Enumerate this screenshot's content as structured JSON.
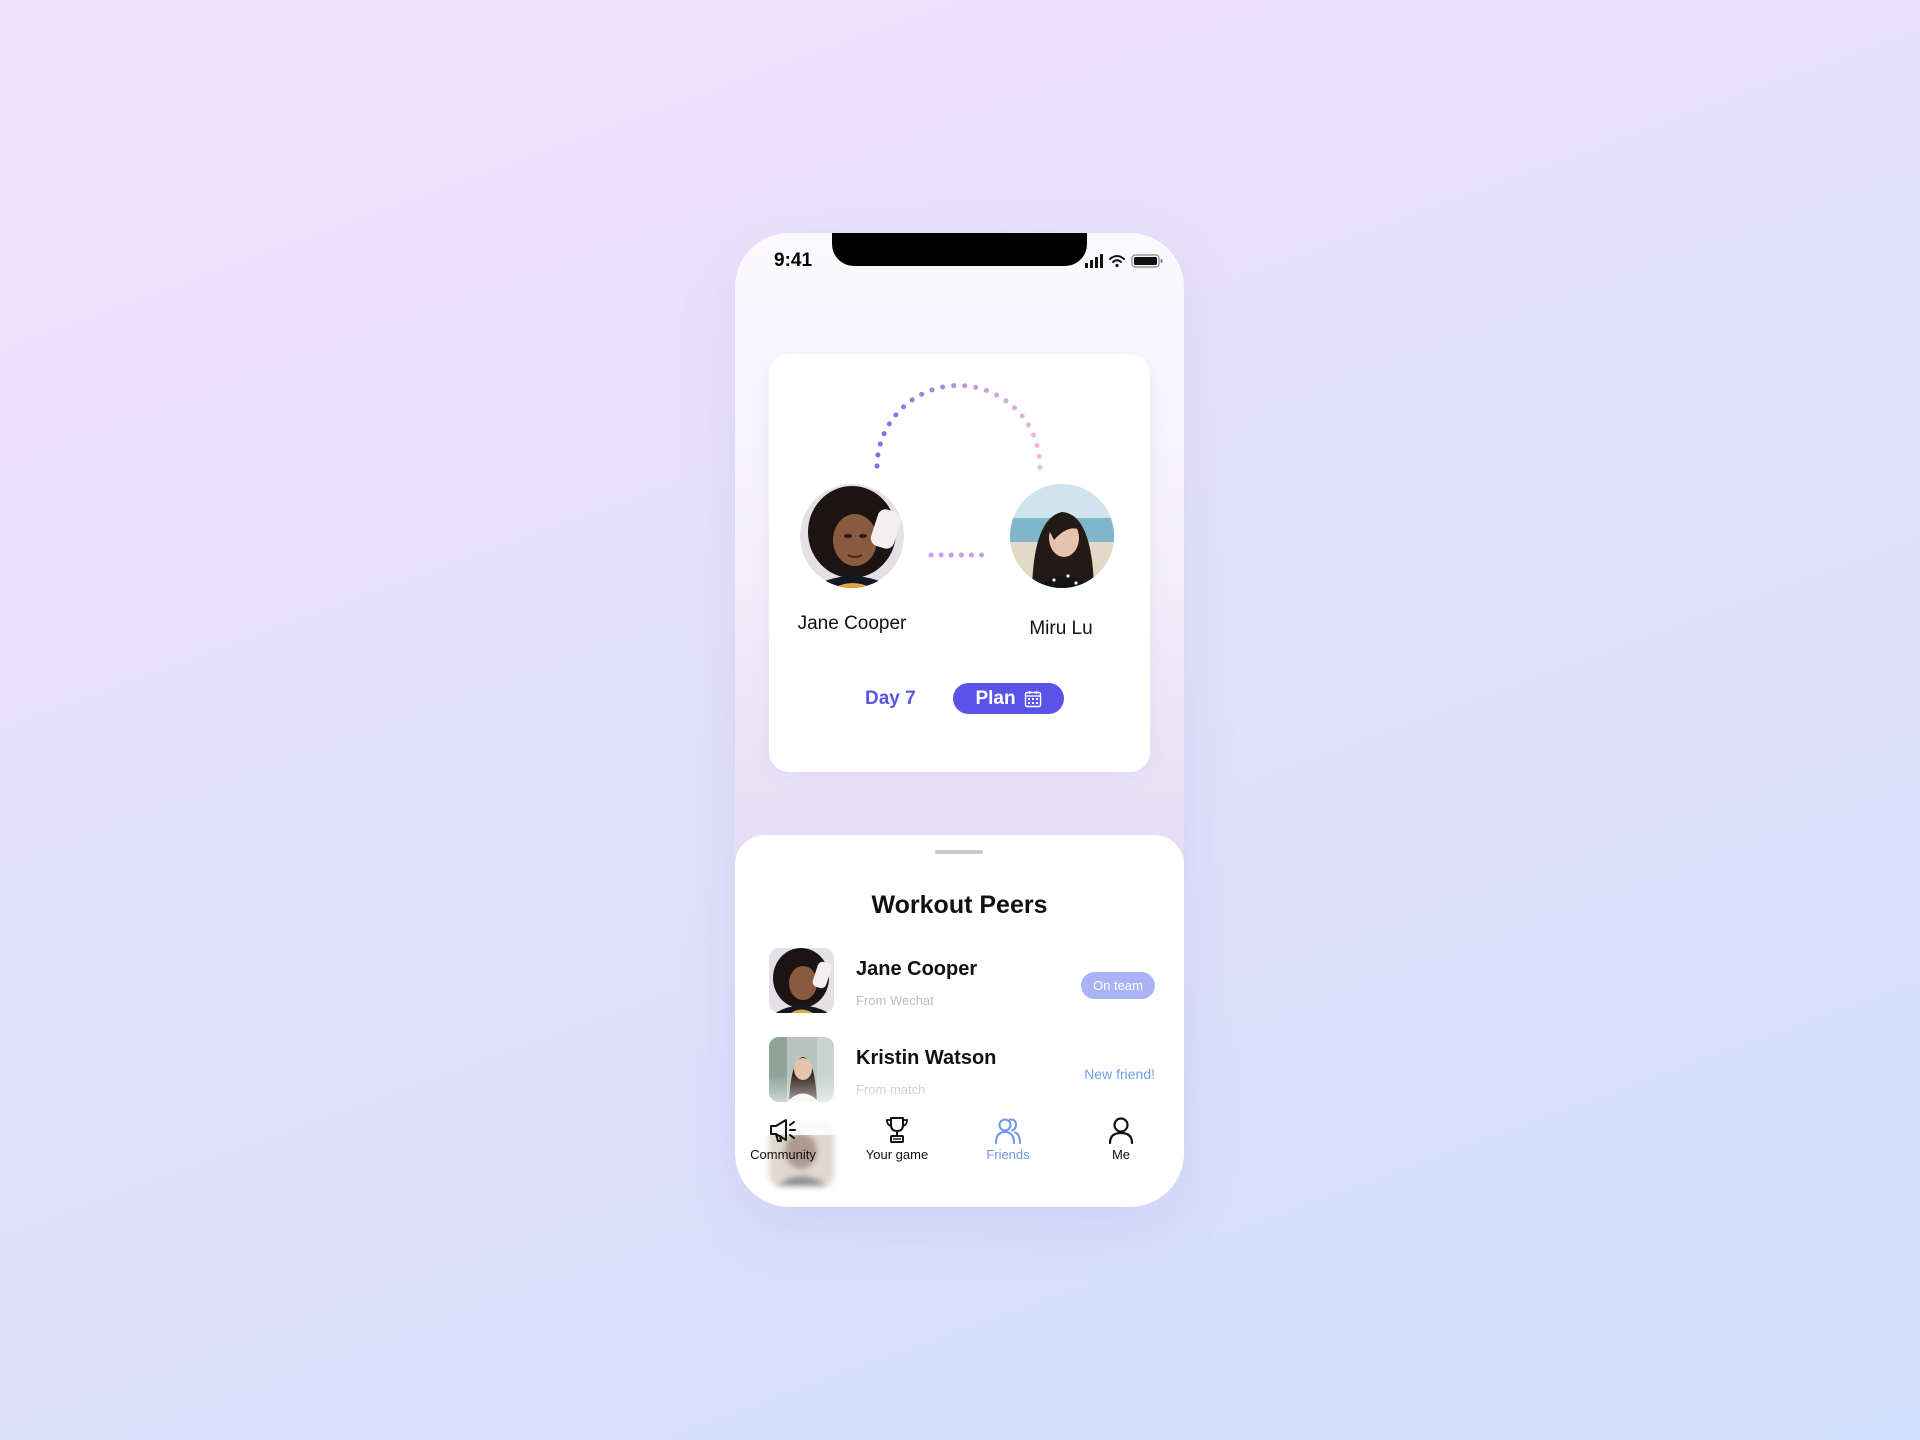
{
  "status_bar": {
    "time": "9:41"
  },
  "pair_card": {
    "left_user": {
      "name": "Jane Cooper"
    },
    "right_user": {
      "name": "Miru Lu"
    },
    "day_label": "Day 7",
    "plan_button_label": "Plan"
  },
  "sheet": {
    "title": "Workout Peers",
    "peers": [
      {
        "name": "Jane Cooper",
        "source": "From Wechat",
        "status": "On team"
      },
      {
        "name": "Kristin Watson",
        "source": "From match",
        "status": "New friend!"
      }
    ]
  },
  "tab_bar": {
    "items": [
      {
        "label": "Community",
        "icon": "megaphone-icon"
      },
      {
        "label": "Your game",
        "icon": "trophy-icon"
      },
      {
        "label": "Friends",
        "icon": "friends-icon",
        "active": true
      },
      {
        "label": "Me",
        "icon": "person-icon"
      }
    ]
  },
  "colors": {
    "accent": "#5b53e8",
    "badge": "#a9b3f6",
    "link": "#6aa0ee",
    "active_tab": "#6c97e6"
  }
}
